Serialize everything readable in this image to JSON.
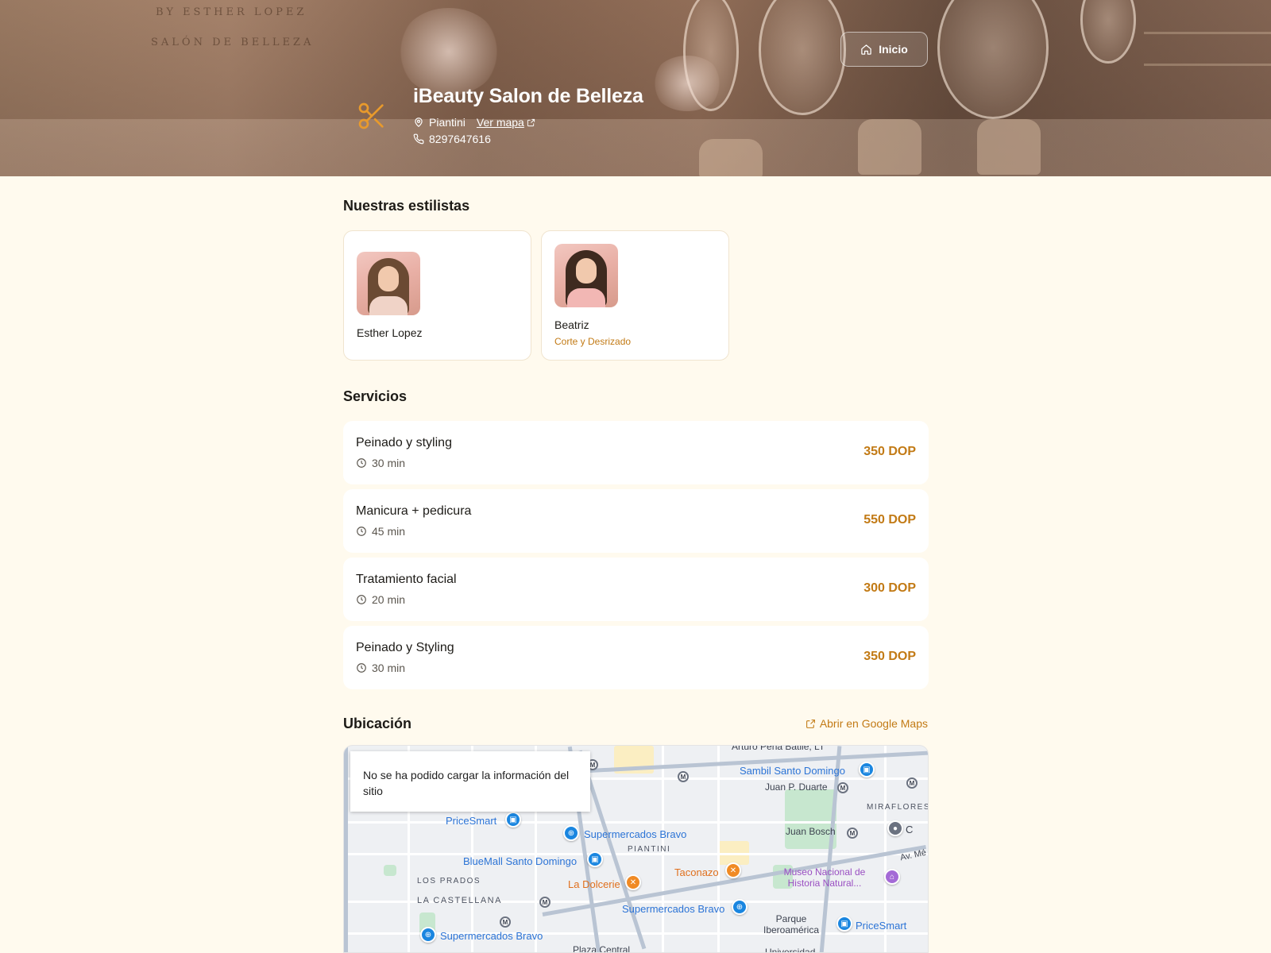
{
  "hero": {
    "brand_top": "BY ESTHER LOPEZ",
    "brand_sub": "SALÓN DE BELLEZA",
    "home_label": "Inicio",
    "salon_name": "iBeauty Salon de Belleza",
    "location": "Piantini",
    "map_link": "Ver mapa",
    "phone": "8297647616"
  },
  "stylists": {
    "title": "Nuestras estilistas",
    "items": [
      {
        "name": "Esther Lopez",
        "specialty": ""
      },
      {
        "name": "Beatriz",
        "specialty": "Corte y Desrizado"
      }
    ]
  },
  "services": {
    "title": "Servicios",
    "items": [
      {
        "name": "Peinado y styling",
        "duration": "30 min",
        "price": "350 DOP"
      },
      {
        "name": "Manicura + pedicura",
        "duration": "45 min",
        "price": "550 DOP"
      },
      {
        "name": "Tratamiento facial",
        "duration": "20 min",
        "price": "300 DOP"
      },
      {
        "name": "Peinado y Styling",
        "duration": "30 min",
        "price": "350 DOP"
      }
    ]
  },
  "location": {
    "title": "Ubicación",
    "gmaps_link": "Abrir en Google Maps",
    "map_error": "No se ha podido cargar la información del sitio",
    "map_labels": {
      "arturo": "Arturo Peña Batlle, LT",
      "sambil": "Sambil Santo Domingo",
      "juan_duarte": "Juan P. Duarte",
      "miraflores": "MIRAFLORES",
      "pricesmart1": "PriceSmart",
      "super_bravo1": "Supermercados Bravo",
      "piantini": "PIANTINI",
      "juan_bosch": "Juan Bosch",
      "bluemall": "BlueMall Santo Domingo",
      "av": "Av. Mé",
      "museo": "Museo Nacional de Historia Natural...",
      "los_prados": "LOS PRADOS",
      "la_dolcerie": "La Dolcerie",
      "taconazo": "Taconazo",
      "la_castellana": "LA CASTELLANA",
      "super_bravo2": "Supermercados Bravo",
      "parque": "Parque Iberoamérica",
      "pricesmart2": "PriceSmart",
      "super_bravo3": "Supermercados Bravo",
      "plaza_central": "Plaza Central",
      "universidad": "Universidad",
      "c_letter": "C"
    }
  },
  "colors": {
    "accent": "#c27a15",
    "background": "#fffaee",
    "card": "#ffffff"
  },
  "icons": {
    "home": "home-icon",
    "scissors": "scissors-icon",
    "pin": "map-pin-icon",
    "phone": "phone-icon",
    "clock": "clock-icon",
    "external": "external-link-icon"
  }
}
